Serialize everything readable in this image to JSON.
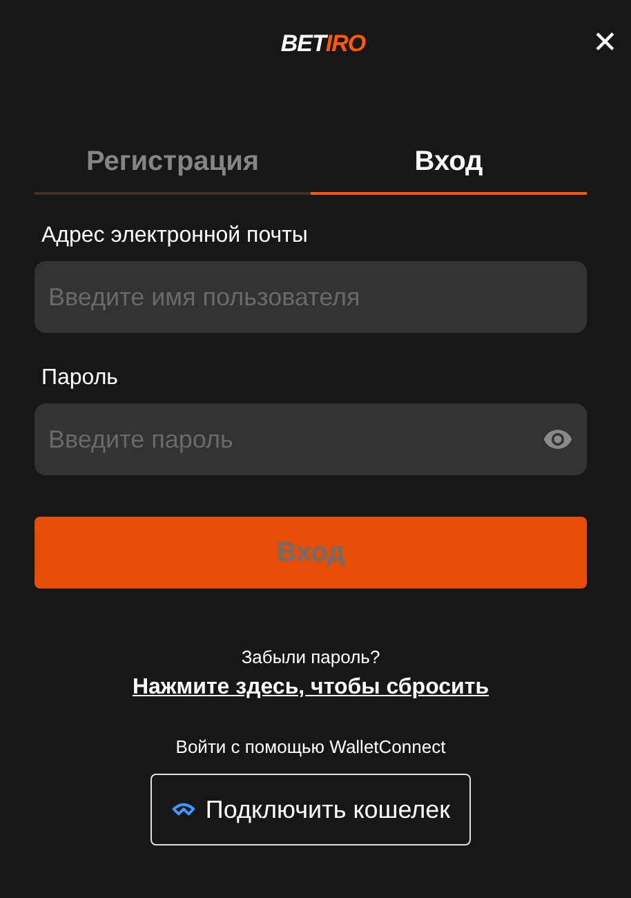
{
  "logo": {
    "parts": [
      {
        "text": "BET",
        "accent": false
      },
      {
        "text": "IRO",
        "accent": true
      }
    ]
  },
  "close": {
    "label": "✕"
  },
  "tabs": [
    {
      "label": "Регистрация",
      "selected": false
    },
    {
      "label": "Вход",
      "selected": true
    }
  ],
  "fields": [
    {
      "label": "Адрес электронной почты",
      "placeholder": "Введите имя пользователя",
      "kind": "text"
    },
    {
      "label": "Пароль",
      "placeholder": "Введите пароль",
      "kind": "password"
    }
  ],
  "submit": {
    "label": "Вход",
    "disabled": true
  },
  "forgot": {
    "text": "Забыли пароль?",
    "link": "Нажмите здесь, чтобы сбросить"
  },
  "wallet": {
    "text": "Войти с помощью WalletConnect",
    "button": "Подключить кошелек"
  }
}
